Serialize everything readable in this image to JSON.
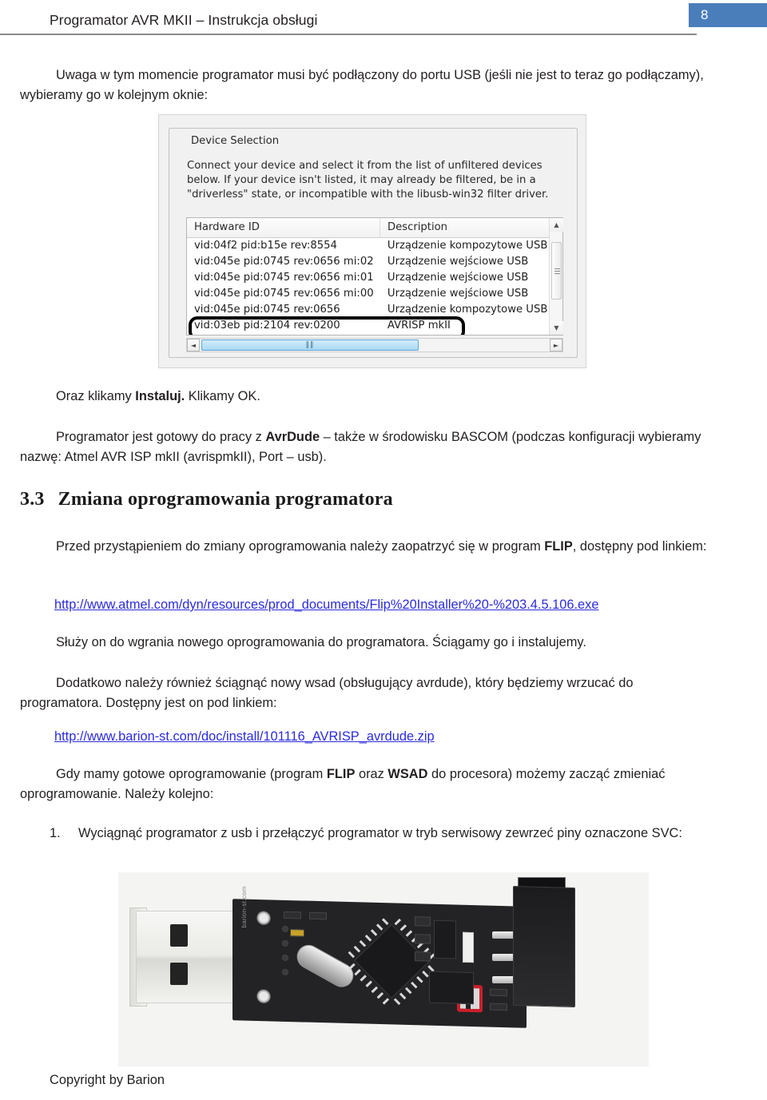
{
  "header": {
    "title": "Programator AVR MKII – Instrukcja obsługi",
    "page_number": "8",
    "badge_color": "#4a7ebb"
  },
  "body": {
    "intro_paragraph": "Uwaga w tym momencie programator musi być podłączony do portu USB (jeśli nie jest to teraz go podłączamy), wybieramy go w kolejnym oknie:",
    "after_screenshot_1": "Oraz klikamy ",
    "after_screenshot_1_bold": "Instaluj.",
    "after_screenshot_1_rest": " Klikamy OK.",
    "ready_para_1": "Programator jest gotowy do pracy z ",
    "ready_para_bold": "AvrDude",
    "ready_para_2": " – także w środowisku BASCOM (podczas konfiguracji wybieramy nazwę: Atmel AVR ISP mkII (avrispmkII),  Port – usb)."
  },
  "section": {
    "number": "3.3",
    "title": "Zmiana oprogramowania programatora",
    "flip_para_1": "Przed przystąpieniem do zmiany oprogramowania należy zaopatrzyć się w program ",
    "flip_para_bold": "FLIP",
    "flip_para_2": ", dostępny pod linkiem:",
    "link_flip": "http://www.atmel.com/dyn/resources/prod_documents/Flip%20Installer%20-%203.4.5.106.exe",
    "serves_para": "Służy on do wgrania nowego oprogramowania do programatora. Ściągamy go i instalujemy.",
    "extra_para": "Dodatkowo należy również ściągnąć nowy wsad (obsługujący avrdude), który będziemy wrzucać do programatora. Dostępny jest on pod linkiem:",
    "link_wsad": "http://www.barion-st.com/doc/install/101116_AVRISP_avrdude.zip",
    "ready_change_1": "Gdy mamy gotowe oprogramowanie (program ",
    "ready_change_bold_1": "FLIP",
    "ready_change_2": " oraz ",
    "ready_change_bold_2": "WSAD",
    "ready_change_3": " do procesora) możemy zacząć zmieniać oprogramowanie. Należy kolejno:"
  },
  "steps": [
    {
      "number": "1.",
      "text": "Wyciągnąć programator z usb i przełączyć programator w tryb serwisowy zewrzeć piny oznaczone SVC:"
    }
  ],
  "dialog": {
    "group_title": "Device Selection",
    "instructions": "Connect your device and select it from the list of unfiltered devices below. If your device isn't listed, it may already be filtered, be in a \"driverless\" state, or incompatible with the libusb-win32 filter driver.",
    "columns": [
      "Hardware ID",
      "Description"
    ],
    "rows": [
      {
        "hardware_id": "vid:04f2 pid:b15e rev:8554",
        "description": "Urządzenie kompozytowe USB",
        "marked": false
      },
      {
        "hardware_id": "vid:045e pid:0745 rev:0656 mi:02",
        "description": "Urządzenie wejściowe USB",
        "marked": false
      },
      {
        "hardware_id": "vid:045e pid:0745 rev:0656 mi:01",
        "description": "Urządzenie wejściowe USB",
        "marked": false
      },
      {
        "hardware_id": "vid:045e pid:0745 rev:0656 mi:00",
        "description": "Urządzenie wejściowe USB",
        "marked": false
      },
      {
        "hardware_id": "vid:045e pid:0745 rev:0656",
        "description": "Urządzenie kompozytowe USB",
        "marked": false
      },
      {
        "hardware_id": "vid:03eb pid:2104 rev:0200",
        "description": "AVRISP mkII",
        "marked": true
      }
    ],
    "scroll_up_glyph": "▲",
    "scroll_down_glyph": "▼",
    "scroll_left_glyph": "◄",
    "scroll_right_glyph": "►",
    "hthumb_grip": "‖‖"
  },
  "photo": {
    "caption_alt": "Fotografia programatora AVR ISP mkII na złączu USB z zaznaczonymi na czerwono pinami SVC",
    "board_silk": "barion-st.com",
    "marker_color": "#cc1f2a"
  },
  "footer": {
    "copyright": "Copyright by Barion"
  }
}
